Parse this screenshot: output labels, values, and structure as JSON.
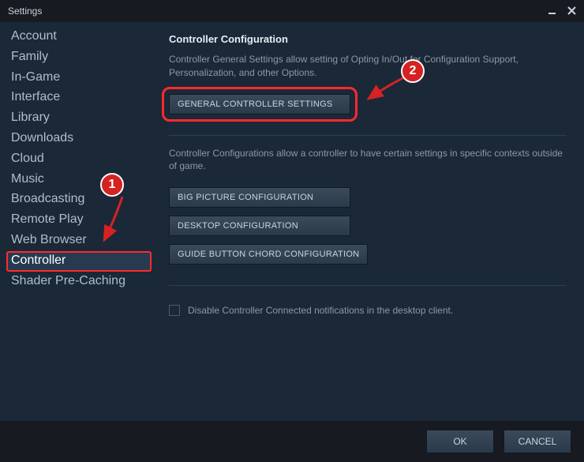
{
  "window": {
    "title": "Settings"
  },
  "sidebar": {
    "items": [
      {
        "label": "Account"
      },
      {
        "label": "Family"
      },
      {
        "label": "In-Game"
      },
      {
        "label": "Interface"
      },
      {
        "label": "Library"
      },
      {
        "label": "Downloads"
      },
      {
        "label": "Cloud"
      },
      {
        "label": "Music"
      },
      {
        "label": "Broadcasting"
      },
      {
        "label": "Remote Play"
      },
      {
        "label": "Web Browser"
      },
      {
        "label": "Controller"
      },
      {
        "label": "Shader Pre-Caching"
      }
    ],
    "selected_index": 11
  },
  "main": {
    "section_title": "Controller Configuration",
    "desc1": "Controller General Settings allow setting of Opting In/Out for Configuration Support, Personalization, and other Options.",
    "btn_general": "GENERAL CONTROLLER SETTINGS",
    "desc2": "Controller Configurations allow a controller to have certain settings in specific contexts outside of game.",
    "btn_bigpic": "BIG PICTURE CONFIGURATION",
    "btn_desktop": "DESKTOP CONFIGURATION",
    "btn_guide": "GUIDE BUTTON CHORD CONFIGURATION",
    "check_label": "Disable Controller Connected notifications in the desktop client."
  },
  "footer": {
    "ok": "OK",
    "cancel": "CANCEL"
  },
  "annotations": {
    "badge1": "1",
    "badge2": "2"
  }
}
